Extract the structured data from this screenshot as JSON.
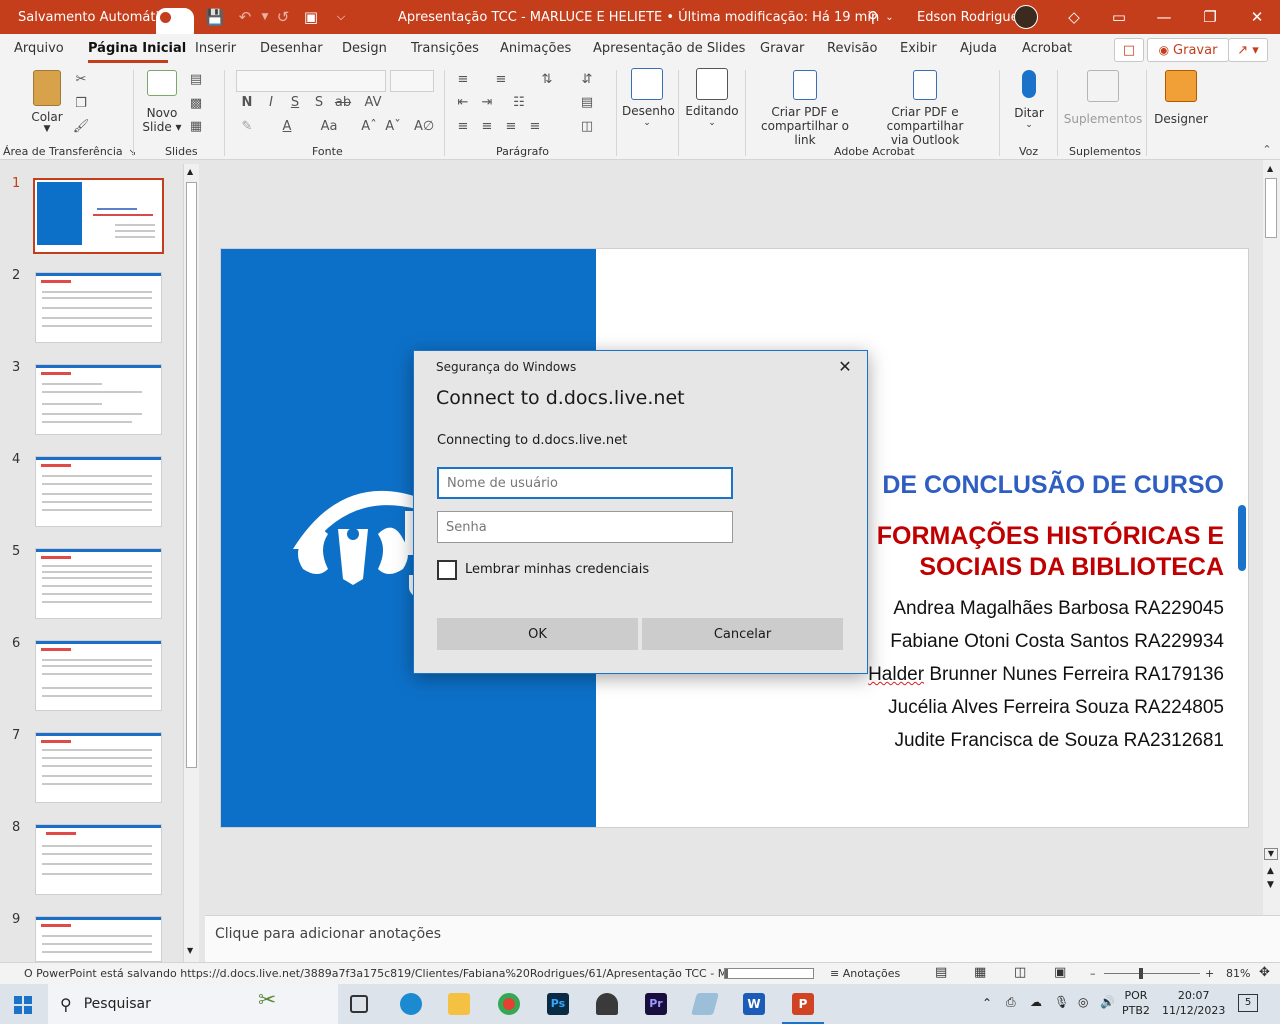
{
  "titlebar": {
    "autosave_label": "Salvamento Automático",
    "autosave_state": "Sim",
    "document_title": "Apresentação TCC -  MARLUCE E HELIETE  •  Última modificação: Há 19 min",
    "user_name": "Edson Rodrigues"
  },
  "tabs": [
    "Arquivo",
    "Página Inicial",
    "Inserir",
    "Desenhar",
    "Design",
    "Transições",
    "Animações",
    "Apresentação de Slides",
    "Gravar",
    "Revisão",
    "Exibir",
    "Ajuda",
    "Acrobat"
  ],
  "record_button": "Gravar",
  "ribbon": {
    "paste_label": "Colar",
    "new_slide_label_1": "Novo",
    "new_slide_label_2": "Slide",
    "drawing_label": "Desenho",
    "editing_label": "Editando",
    "create_pdf_link_1": "Criar PDF e",
    "create_pdf_link_2": "compartilhar o link",
    "create_pdf_outlook_1": "Criar PDF e compartilhar",
    "create_pdf_outlook_2": "via Outlook",
    "dictate_label": "Ditar",
    "addins_label": "Suplementos",
    "designer_label": "Designer",
    "groups": {
      "clipboard": "Área de Transferência",
      "slides": "Slides",
      "font": "Fonte",
      "paragraph": "Parágrafo",
      "adobe": "Adobe Acrobat",
      "voice": "Voz",
      "addins": "Suplementos"
    }
  },
  "thumbnails": [
    "1",
    "2",
    "3",
    "4",
    "5",
    "6",
    "7",
    "8",
    "9"
  ],
  "slide": {
    "title_line": "DE CONCLUSÃO DE CURSO",
    "subtitle_line1": "FORMAÇÕES HISTÓRICAS E",
    "subtitle_line2": "SOCIAIS DA BIBLIOTECA",
    "authors": [
      {
        "name": "Andrea Magalhães Barbosa  RA229045"
      },
      {
        "name": "Fabiane Otoni Costa Santos RA229934"
      },
      {
        "name_first": "Halder",
        "name_rest": " Brunner Nunes Ferreira  RA179136"
      },
      {
        "name": "Jucélia Alves Ferreira Souza RA224805"
      },
      {
        "name": "Judite Francisca de Souza RA2312681"
      }
    ]
  },
  "notes_placeholder": "Clique para adicionar anotações",
  "statusbar": {
    "saving_text": "O PowerPoint está salvando https://d.docs.live.net/3889a7f3a175c819/Clientes/Fabiana%20Rodrigues/61/Apresentação TCC -  MARLUCE",
    "notes_label": "Anotações",
    "zoom": "81%",
    "save_progress": 0.03
  },
  "taskbar": {
    "search_label": "Pesquisar",
    "lang_1": "POR",
    "lang_2": "PTB2",
    "time": "20:07",
    "date": "11/12/2023",
    "notification_count": "5"
  },
  "dialog": {
    "caption": "Segurança do Windows",
    "title": "Connect to d.docs.live.net",
    "message": "Connecting to d.docs.live.net",
    "username_placeholder": "Nome de usuário",
    "password_placeholder": "Senha",
    "remember_label": "Lembrar minhas credenciais",
    "ok_label": "OK",
    "cancel_label": "Cancelar"
  },
  "colors": {
    "accent": "#c43e1c",
    "slide_blue": "#0d70c8",
    "dialog_border": "#1b73c9"
  }
}
